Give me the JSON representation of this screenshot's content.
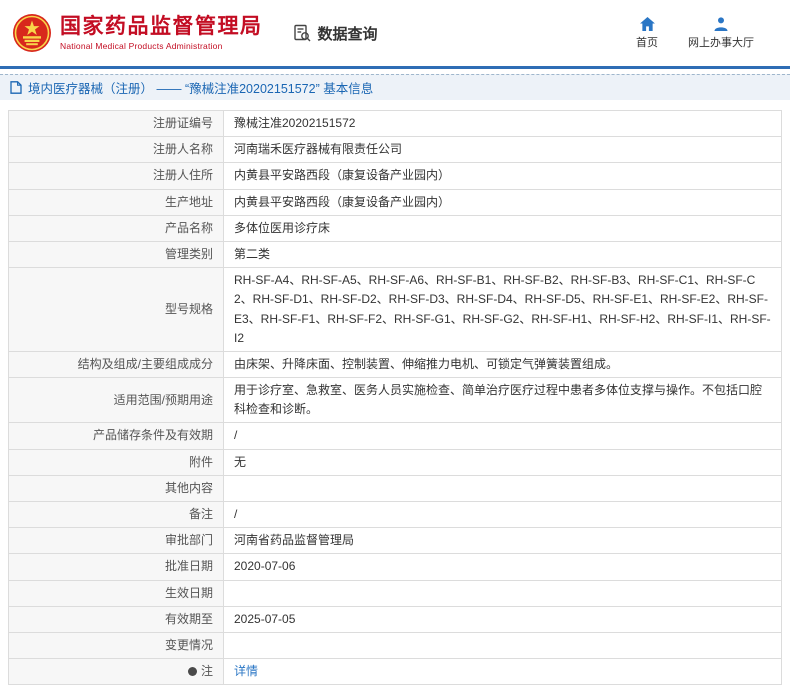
{
  "header": {
    "org_cn": "国家药品监督管理局",
    "org_en": "National Medical Products Administration",
    "nav_query": "数据查询",
    "home_label": "首页",
    "hall_label": "网上办事大厅"
  },
  "breadcrumb": {
    "text": "境内医疗器械（注册） —— “豫械注准20202151572” 基本信息"
  },
  "colors": {
    "brand_red": "#c30d23",
    "link_blue": "#2a76c5",
    "divider_blue": "#2e6db5"
  },
  "table": {
    "rows": [
      {
        "label": "注册证编号",
        "value": "豫械注准20202151572"
      },
      {
        "label": "注册人名称",
        "value": "河南瑞禾医疗器械有限责任公司"
      },
      {
        "label": "注册人住所",
        "value": "内黄县平安路西段（康复设备产业园内）"
      },
      {
        "label": "生产地址",
        "value": "内黄县平安路西段（康复设备产业园内）"
      },
      {
        "label": "产品名称",
        "value": "多体位医用诊疗床"
      },
      {
        "label": "管理类别",
        "value": "第二类"
      },
      {
        "label": "型号规格",
        "value": "RH-SF-A4、RH-SF-A5、RH-SF-A6、RH-SF-B1、RH-SF-B2、RH-SF-B3、RH-SF-C1、RH-SF-C2、RH-SF-D1、RH-SF-D2、RH-SF-D3、RH-SF-D4、RH-SF-D5、RH-SF-E1、RH-SF-E2、RH-SF-E3、RH-SF-F1、RH-SF-F2、RH-SF-G1、RH-SF-G2、RH-SF-H1、RH-SF-H2、RH-SF-I1、RH-SF-I2"
      },
      {
        "label": "结构及组成/主要组成成分",
        "value": "由床架、升降床面、控制装置、伸缩推力电机、可锁定气弹簧装置组成。"
      },
      {
        "label": "适用范围/预期用途",
        "value": "用于诊疗室、急救室、医务人员实施检查、简单治疗医疗过程中患者多体位支撑与操作。不包括口腔科检查和诊断。"
      },
      {
        "label": "产品储存条件及有效期",
        "value": "/"
      },
      {
        "label": "附件",
        "value": "无"
      },
      {
        "label": "其他内容",
        "value": ""
      },
      {
        "label": "备注",
        "value": "/"
      },
      {
        "label": "审批部门",
        "value": "河南省药品监督管理局"
      },
      {
        "label": "批准日期",
        "value": "2020-07-06"
      },
      {
        "label": "生效日期",
        "value": ""
      },
      {
        "label": "有效期至",
        "value": "2025-07-05"
      },
      {
        "label": "变更情况",
        "value": ""
      },
      {
        "label": "注",
        "value": "详情",
        "link": true,
        "icon": "note-icon"
      }
    ]
  }
}
